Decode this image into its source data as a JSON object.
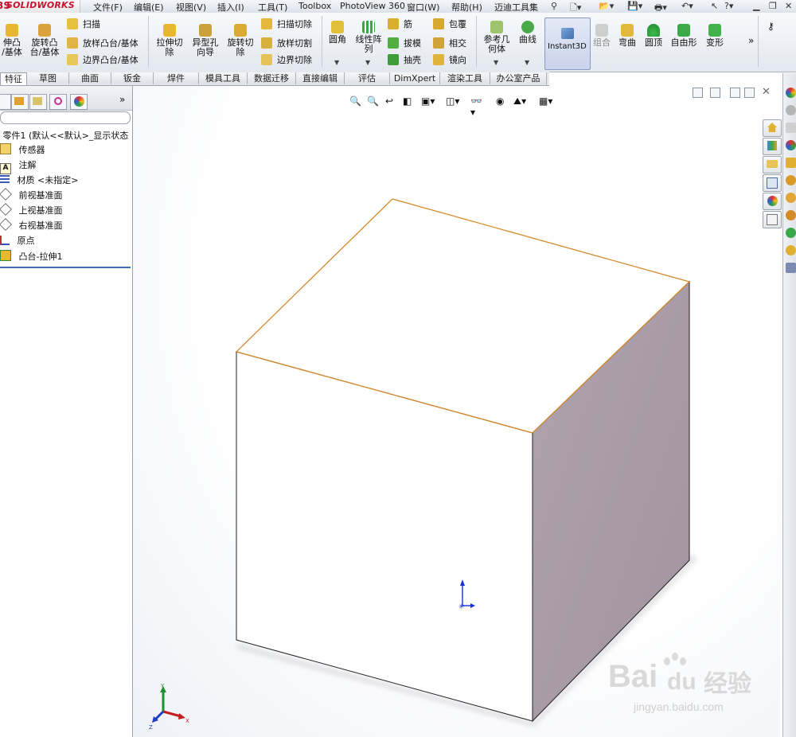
{
  "app": {
    "logo_ds": "3S",
    "logo_name": "SOLIDWORKS"
  },
  "menu": [
    "文件(F)",
    "编辑(E)",
    "视图(V)",
    "插入(I)",
    "工具(T)",
    "Toolbox",
    "PhotoView 360",
    "窗口(W)",
    "帮助(H)",
    "迈迪工具集"
  ],
  "ribbon": {
    "extrude_boss": "伸凸\n/基体",
    "revolve_boss": "旋转凸\n台/基体",
    "sweep": "扫描",
    "loft": "放样凸台/基体",
    "boundary": "边界凸台/基体",
    "extrude_cut": "拉伸切\n除",
    "hole_wizard": "异型孔\n向导",
    "revolve_cut": "旋转切\n除",
    "sweep_cut": "扫描切除",
    "loft_cut": "放样切割",
    "boundary_cut": "边界切除",
    "fillet": "圆角",
    "linear_pattern": "线性阵\n列",
    "rib": "筋",
    "draft": "拔模",
    "shell": "抽壳",
    "wrap": "包覆",
    "intersect": "相交",
    "mirror": "镜向",
    "ref_geometry": "参考几\n何体",
    "curves": "曲线",
    "instant3d": "Instant3D",
    "combine": "组合",
    "flex": "弯曲",
    "dome": "圆顶",
    "freeform": "自由形",
    "deform": "变形",
    "more": "»"
  },
  "tabs": [
    "特征",
    "草图",
    "曲面",
    "钣金",
    "焊件",
    "模具工具",
    "数据迁移",
    "直接编辑",
    "评估",
    "DimXpert",
    "渲染工具",
    "办公室产品"
  ],
  "active_tab": "特征",
  "tree": {
    "root": "零件1 (默认<<默认>_显示状态",
    "items": [
      "传感器",
      "注解",
      "材质 <未指定>",
      "前视基准面",
      "上视基准面",
      "右视基准面",
      "原点",
      "凸台-拉伸1"
    ]
  },
  "panel_more": "»",
  "triad": {
    "y": "Y",
    "x": "X",
    "z": "Z"
  },
  "watermark": {
    "brand": "Bai",
    "du": "du",
    "cn": "经验",
    "url": "jingyan.baidu.com"
  },
  "colors": {
    "edge_highlight": "#d68a2e",
    "cube_side": "#a99ca9",
    "cube_front": "#ffffff"
  }
}
